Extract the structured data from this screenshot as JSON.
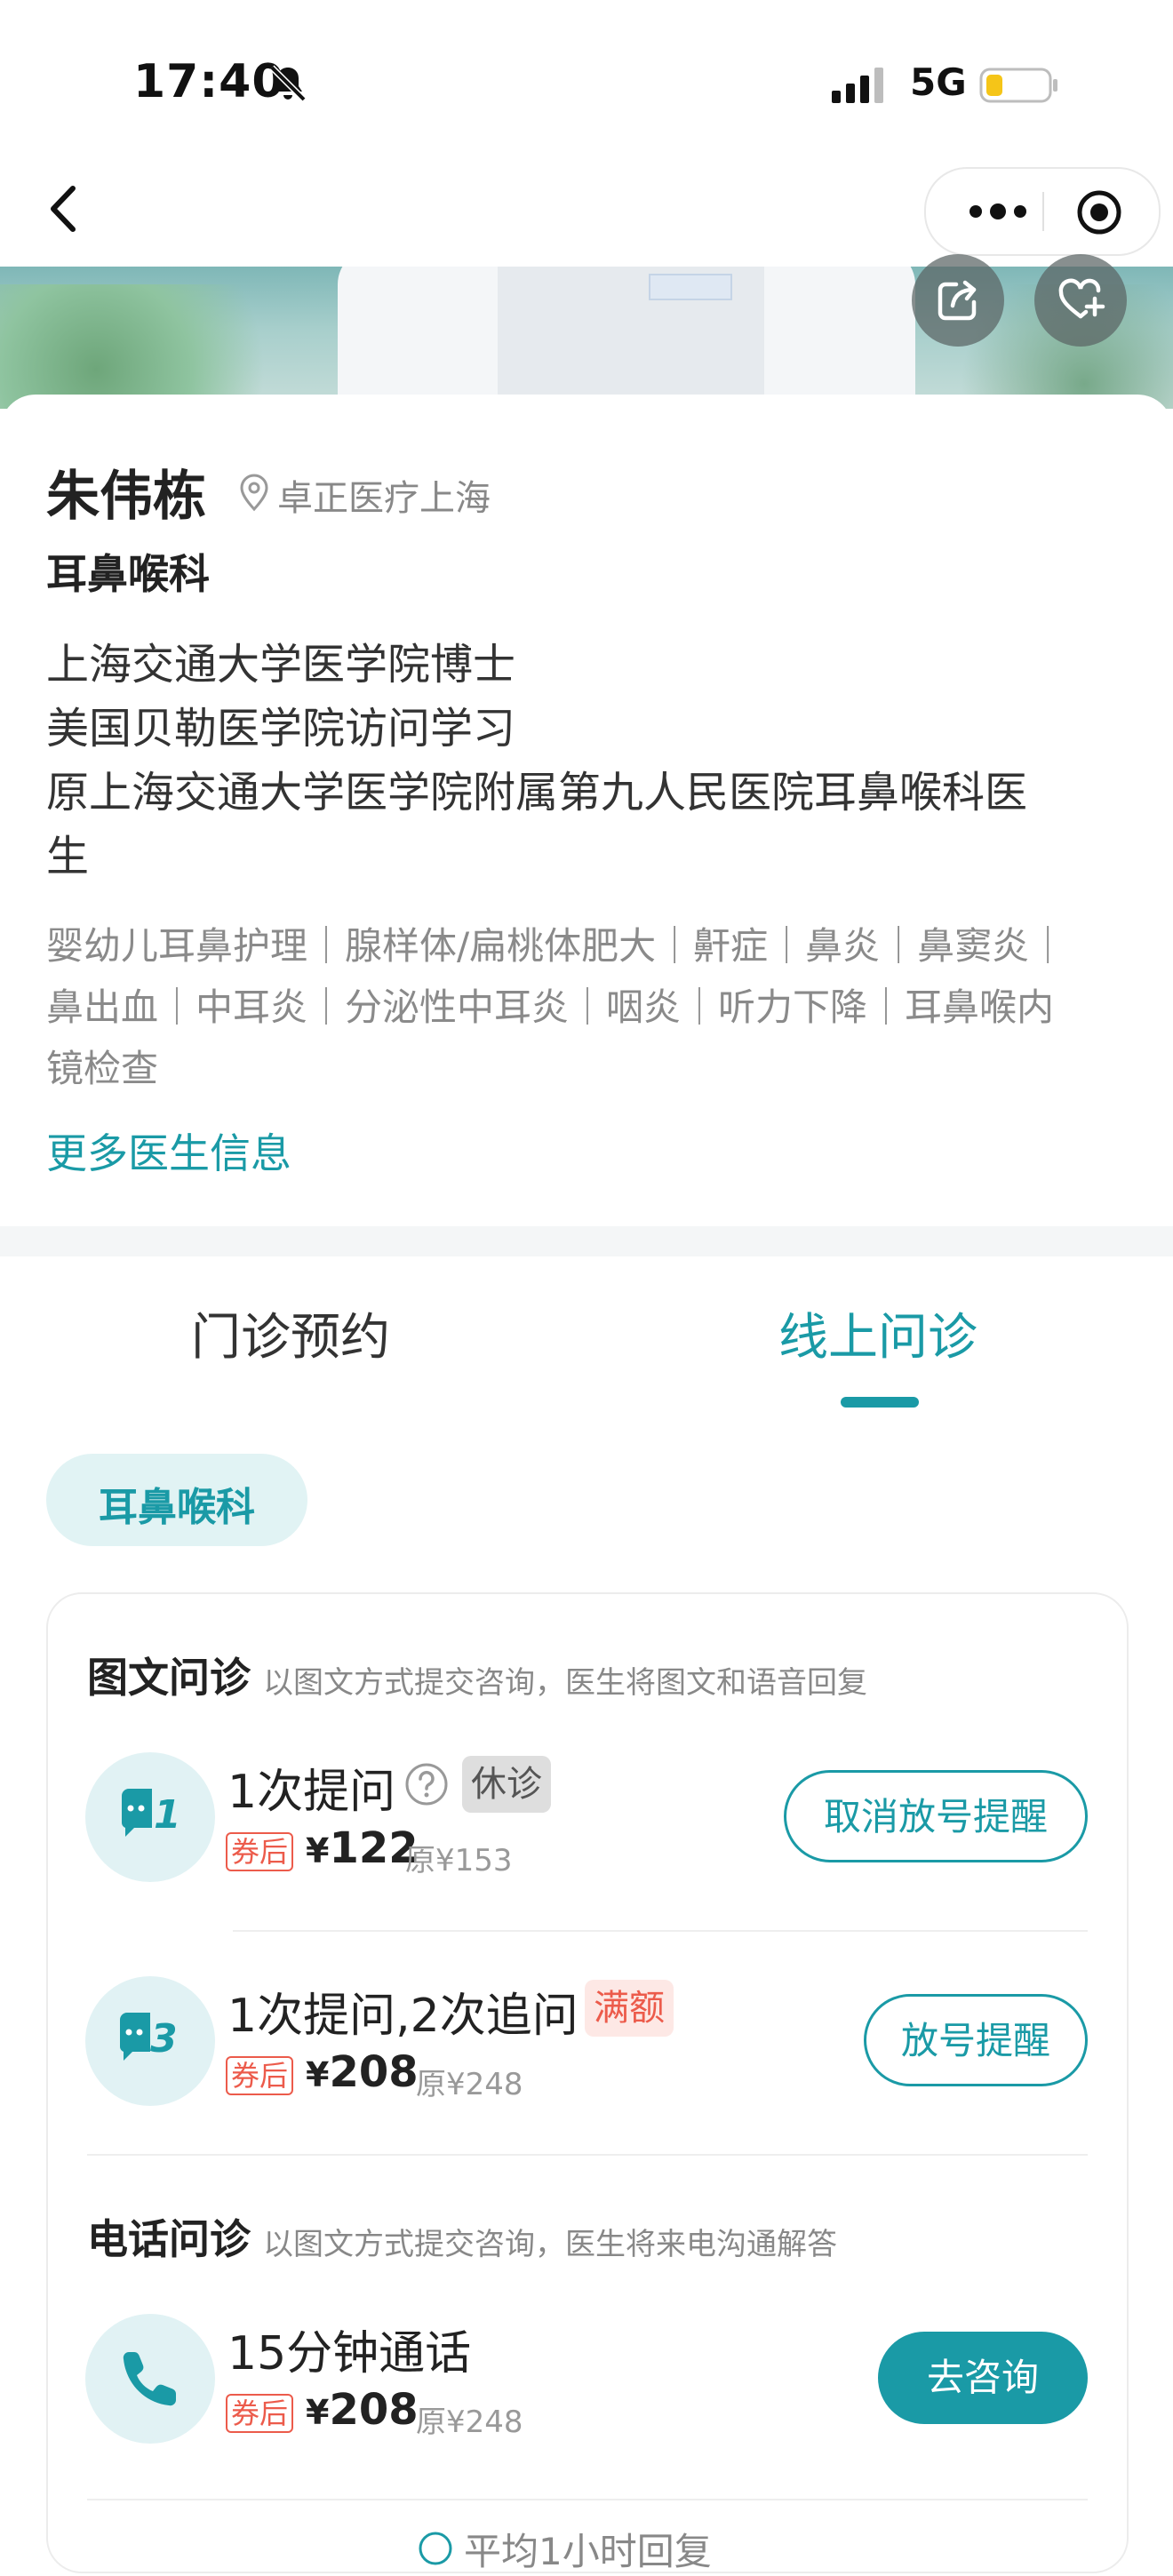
{
  "status_bar": {
    "time": "17:40",
    "network": "5G"
  },
  "colors": {
    "accent": "#1a9aa6",
    "coupon_red": "#ec5b4b",
    "muted": "#888888"
  },
  "doctor": {
    "name": "朱伟栋",
    "location": "卓正医疗上海",
    "department": "耳鼻喉科",
    "bio_lines": [
      "上海交通大学医学院博士",
      "美国贝勒医学院访问学习",
      "原上海交通大学医学院附属第九人民医院耳鼻喉科医",
      "生"
    ],
    "tag_lines": [
      "婴幼儿耳鼻护理｜腺样体/扁桃体肥大｜鼾症｜鼻炎｜鼻窦炎｜",
      "鼻出血｜中耳炎｜分泌性中耳炎｜咽炎｜听力下降｜耳鼻喉内",
      "镜检查"
    ],
    "more_info_link": "更多医生信息"
  },
  "tabs": {
    "offline": "门诊预约",
    "online": "线上问诊"
  },
  "dept_chip": "耳鼻喉科",
  "text_consult": {
    "title": "图文问诊",
    "desc": "以图文方式提交咨询，医生将图文和语音回复",
    "items": [
      {
        "icon": "chat-bubble-1-icon",
        "name": "1次提问",
        "status": "休诊",
        "coupon": "券后",
        "currency": "¥",
        "price": "122",
        "original": "原¥153",
        "button": "取消放号提醒"
      },
      {
        "icon": "chat-bubble-3-icon",
        "name": "1次提问,2次追问",
        "status": "满额",
        "coupon": "券后",
        "currency": "¥",
        "price": "208",
        "original": "原¥248",
        "button": "放号提醒"
      }
    ]
  },
  "phone_consult": {
    "title": "电话问诊",
    "desc": "以图文方式提交咨询，医生将来电沟通解答",
    "items": [
      {
        "icon": "phone-icon",
        "name": "15分钟通话",
        "coupon": "券后",
        "currency": "¥",
        "price": "208",
        "original": "原¥248",
        "button": "去咨询"
      }
    ]
  },
  "footer_hint": "平均1小时回复"
}
